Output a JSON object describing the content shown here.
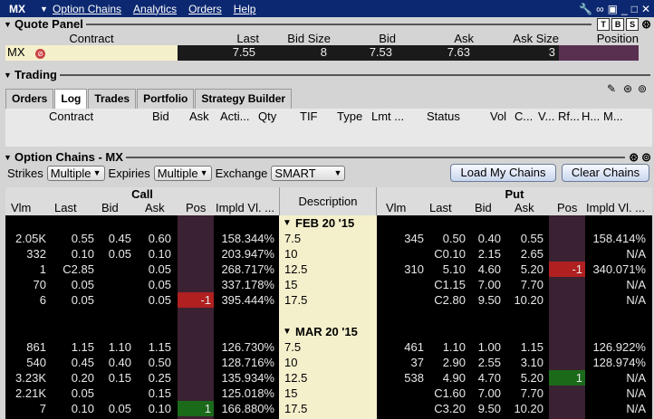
{
  "menubar": {
    "symbol": "MX",
    "items": [
      "Option Chains",
      "Analytics",
      "Orders",
      "Help"
    ]
  },
  "quote_panel": {
    "title": "Quote Panel",
    "headers": [
      "Contract",
      "Last",
      "Bid Size",
      "Bid",
      "Ask",
      "Ask Size",
      "Position"
    ],
    "row": {
      "contract": "MX",
      "last": "7.55",
      "bid_size": "8",
      "bid": "7.53",
      "ask": "7.63",
      "ask_size": "3",
      "position": ""
    },
    "badges": [
      "T",
      "B",
      "S"
    ]
  },
  "trading": {
    "title": "Trading",
    "tabs": [
      "Orders",
      "Log",
      "Trades",
      "Portfolio",
      "Strategy Builder"
    ],
    "headers": [
      "Contract",
      "Bid",
      "Ask",
      "Acti...",
      "Qty",
      "TIF",
      "Type",
      "Lmt ...",
      "Status",
      "Vol",
      "C...",
      "V...",
      "Rf...",
      "H...",
      "M..."
    ]
  },
  "option_chains": {
    "title": "Option Chains - MX",
    "strikes_label": "Strikes",
    "strikes_value": "Multiple",
    "expiries_label": "Expiries",
    "expiries_value": "Multiple",
    "exchange_label": "Exchange",
    "exchange_value": "SMART",
    "load_button": "Load My Chains",
    "clear_button": "Clear Chains",
    "call_header": "Call",
    "put_header": "Put",
    "desc_header": "Description",
    "columns": [
      "Vlm",
      "Last",
      "Bid",
      "Ask",
      "Pos",
      "Impld Vl. ..."
    ],
    "expiry1": "FEB 20 '15",
    "expiry2": "MAR 20 '15",
    "rows": [
      {
        "cvlm": "2.05K",
        "clast": "0.55",
        "cbid": "0.45",
        "cask": "0.60",
        "cpos": "",
        "civ": "158.344%",
        "desc": "7.5",
        "pvlm": "345",
        "plast": "0.50",
        "pbid": "0.40",
        "pask": "0.55",
        "ppos": "",
        "piv": "158.414%"
      },
      {
        "cvlm": "332",
        "clast": "0.10",
        "cbid": "0.05",
        "cask": "0.10",
        "cpos": "",
        "civ": "203.947%",
        "desc": "10",
        "pvlm": "",
        "plast": "C0.10",
        "pbid": "2.15",
        "pask": "2.65",
        "ppos": "",
        "piv": "N/A"
      },
      {
        "cvlm": "1",
        "clast": "C2.85",
        "cbid": "",
        "cask": "0.05",
        "cpos": "",
        "civ": "268.717%",
        "desc": "12.5",
        "pvlm": "310",
        "plast": "5.10",
        "pbid": "4.60",
        "pask": "5.20",
        "ppos": "-1",
        "piv": "340.071%"
      },
      {
        "cvlm": "70",
        "clast": "0.05",
        "cbid": "",
        "cask": "0.05",
        "cpos": "",
        "civ": "337.178%",
        "desc": "15",
        "pvlm": "",
        "plast": "C1.15",
        "pbid": "7.00",
        "pask": "7.70",
        "ppos": "",
        "piv": "N/A"
      },
      {
        "cvlm": "6",
        "clast": "0.05",
        "cbid": "",
        "cask": "0.05",
        "cpos": "-1",
        "civ": "395.444%",
        "desc": "17.5",
        "pvlm": "",
        "plast": "C2.80",
        "pbid": "9.50",
        "pask": "10.20",
        "ppos": "",
        "piv": "N/A"
      },
      {
        "cvlm": "861",
        "clast": "1.15",
        "cbid": "1.10",
        "cask": "1.15",
        "cpos": "",
        "civ": "126.730%",
        "desc": "7.5",
        "pvlm": "461",
        "plast": "1.10",
        "pbid": "1.00",
        "pask": "1.15",
        "ppos": "",
        "piv": "126.922%"
      },
      {
        "cvlm": "540",
        "clast": "0.45",
        "cbid": "0.40",
        "cask": "0.50",
        "cpos": "",
        "civ": "128.716%",
        "desc": "10",
        "pvlm": "37",
        "plast": "2.90",
        "pbid": "2.55",
        "pask": "3.10",
        "ppos": "",
        "piv": "128.974%"
      },
      {
        "cvlm": "3.23K",
        "clast": "0.20",
        "cbid": "0.15",
        "cask": "0.25",
        "cpos": "",
        "civ": "135.934%",
        "desc": "12.5",
        "pvlm": "538",
        "plast": "4.90",
        "pbid": "4.70",
        "pask": "5.20",
        "ppos": "1",
        "piv": "N/A"
      },
      {
        "cvlm": "2.21K",
        "clast": "0.05",
        "cbid": "",
        "cask": "0.15",
        "cpos": "",
        "civ": "125.018%",
        "desc": "15",
        "pvlm": "",
        "plast": "C1.60",
        "pbid": "7.00",
        "pask": "7.70",
        "ppos": "",
        "piv": "N/A"
      },
      {
        "cvlm": "7",
        "clast": "0.10",
        "cbid": "0.05",
        "cask": "0.10",
        "cpos": "1",
        "civ": "166.880%",
        "desc": "17.5",
        "pvlm": "",
        "plast": "C3.20",
        "pbid": "9.50",
        "pask": "10.20",
        "ppos": "",
        "piv": "N/A"
      }
    ]
  },
  "colors": {
    "menubar": "#0c2870",
    "desc_bg": "#f5f0cc",
    "pos_neg": "#b02020",
    "pos_pos": "#1a6a1a"
  }
}
